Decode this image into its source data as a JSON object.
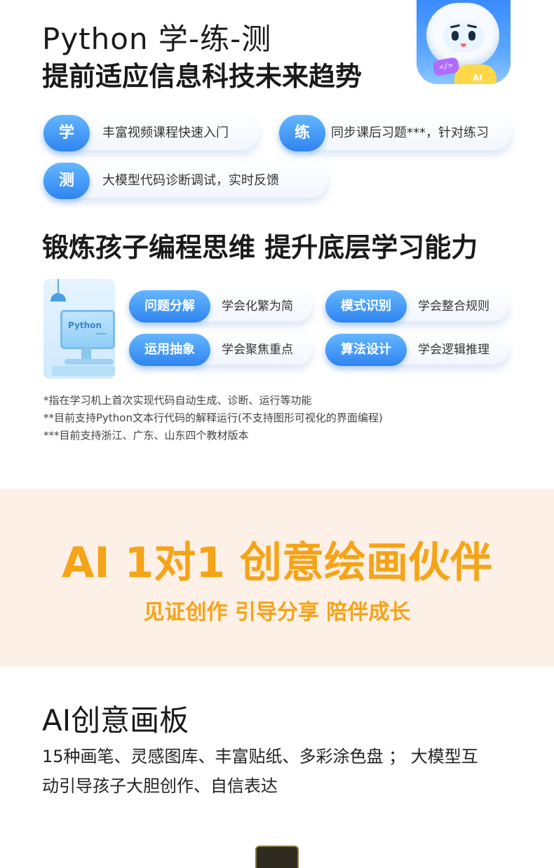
{
  "header": {
    "title_line1": "Python 学-练-测",
    "title_line2": "提前适应信息科技未来趋势",
    "mascot_tag": "</>",
    "mascot_badge": "AI"
  },
  "features": [
    {
      "icon": "学",
      "text": "丰富视频课程快速入门"
    },
    {
      "icon": "练",
      "text": "同步课后习题***，针对练习"
    },
    {
      "icon": "测",
      "text": "大模型代码诊断调试，实时反馈"
    }
  ],
  "thinking": {
    "heading": "锻炼孩子编程思维 提升底层学习能力",
    "screen_text": "Python",
    "skills": [
      {
        "tag": "问题分解",
        "text": "学会化繁为简"
      },
      {
        "tag": "模式识别",
        "text": "学会整合规则"
      },
      {
        "tag": "运用抽象",
        "text": "学会聚焦重点"
      },
      {
        "tag": "算法设计",
        "text": "学会逻辑推理"
      }
    ],
    "footnotes": [
      "*指在学习机上首次实现代码自动生成、诊断、运行等功能",
      "**目前支持Python文本行代码的解释运行(不支持图形可视化的界面编程)",
      "***目前支持浙江、广东、山东四个教材版本"
    ]
  },
  "banner": {
    "title": "AI 1对1 创意绘画伙伴",
    "subtitle": "见证创作 引导分享 陪伴成长",
    "accent_color": "#f5a317",
    "background_color": "#fdf0e6"
  },
  "board": {
    "title": "AI创意画板",
    "desc_line1": "15种画笔、灵感图库、丰富贴纸、多彩涂色盘 ； 大模型互",
    "desc_line2": "动引导孩子大胆创作、自信表达"
  }
}
